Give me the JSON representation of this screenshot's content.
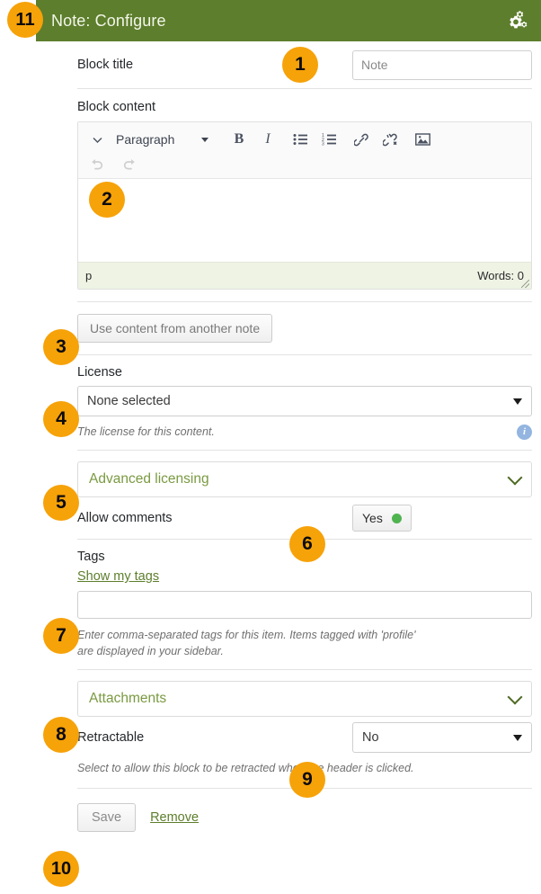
{
  "header": {
    "title": "Note: Configure",
    "close_label": "×",
    "settings_icon": "cogs-icon"
  },
  "form": {
    "block_title": {
      "label": "Block title",
      "value": "Note",
      "placeholder": "Note"
    },
    "block_content": {
      "label": "Block content",
      "toolbar": {
        "expand_icon": "chevron-down-icon",
        "format_select": "Paragraph",
        "bold": "B",
        "italic": "I",
        "bullet_list": "unordered-list-icon",
        "numbered_list": "ordered-list-icon",
        "link": "link-icon",
        "unlink": "unlink-icon",
        "image": "image-icon",
        "undo": "undo-icon",
        "redo": "redo-icon"
      },
      "content": "",
      "status_path": "p",
      "word_count": "Words: 0"
    },
    "use_content_button": "Use content from another note",
    "license": {
      "label": "License",
      "value": "None selected",
      "help": "The license for this content.",
      "info_icon": "info-icon"
    },
    "advanced_licensing": {
      "label": "Advanced licensing",
      "chevron": "chevron-down-icon"
    },
    "allow_comments": {
      "label": "Allow comments",
      "value": "Yes",
      "indicator": "green-dot"
    },
    "tags": {
      "label": "Tags",
      "show_my_tags": "Show my tags",
      "value": "",
      "help_line1": "Enter comma-separated tags for this item. Items tagged with 'profile'",
      "help_line2": "are displayed in your sidebar."
    },
    "attachments": {
      "label": "Attachments",
      "chevron": "chevron-down-icon"
    },
    "retractable": {
      "label": "Retractable",
      "value": "No",
      "help": "Select to allow this block to be retracted when the header is clicked."
    },
    "actions": {
      "save": "Save",
      "remove": "Remove"
    }
  },
  "callouts": [
    {
      "n": "1"
    },
    {
      "n": "2"
    },
    {
      "n": "3"
    },
    {
      "n": "4"
    },
    {
      "n": "5"
    },
    {
      "n": "6"
    },
    {
      "n": "7"
    },
    {
      "n": "8"
    },
    {
      "n": "9"
    },
    {
      "n": "10"
    },
    {
      "n": "11"
    }
  ],
  "colors": {
    "header_green": "#5d7e2c",
    "badge_orange": "#f6a209",
    "link_green": "#5d7e2c",
    "panel_green_text": "#7a9a41",
    "status_dot_green": "#4fb350",
    "info_blue": "#93b5e0"
  }
}
